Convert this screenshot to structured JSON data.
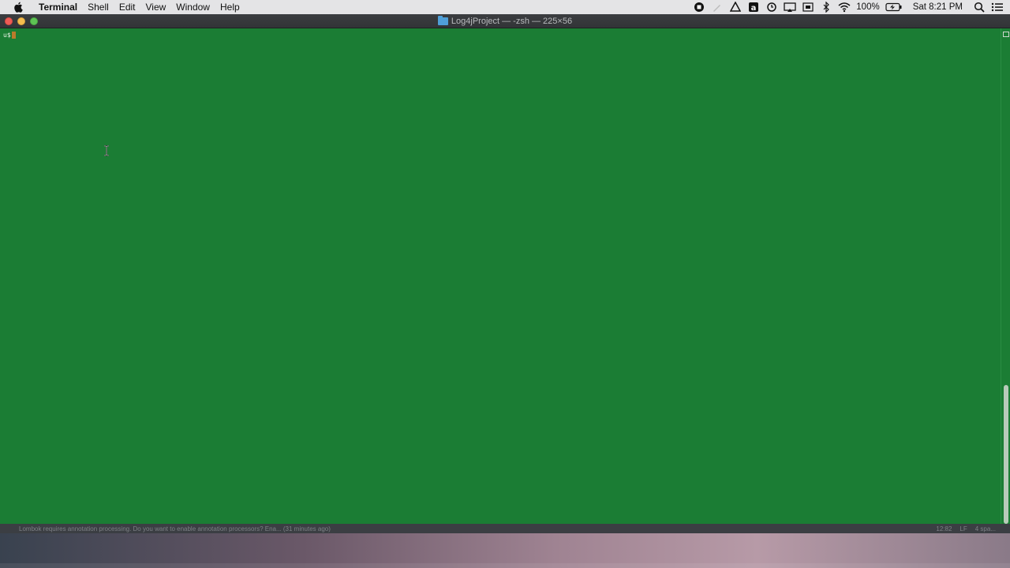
{
  "menubar": {
    "app_name": "Terminal",
    "items": [
      "Shell",
      "Edit",
      "View",
      "Window",
      "Help"
    ],
    "battery": "100%",
    "clock": "Sat 8:21 PM",
    "status_icons": [
      "record-icon",
      "pencil-icon",
      "drive-icon",
      "amazon-icon",
      "timemachine-icon",
      "airplay-icon",
      "keyboard-icon",
      "bluetooth-icon",
      "wifi-icon"
    ]
  },
  "window": {
    "title": "Log4jProject — -zsh — 225×56",
    "prompt": "u$",
    "background_color": "#1b7d34"
  },
  "ide_status": {
    "message": "Lombok requires annotation processing. Do you want to enable annotation processors? Ena... (31 minutes ago)",
    "position": "12:82",
    "line_sep": "LF",
    "indent": "4 spa..."
  }
}
